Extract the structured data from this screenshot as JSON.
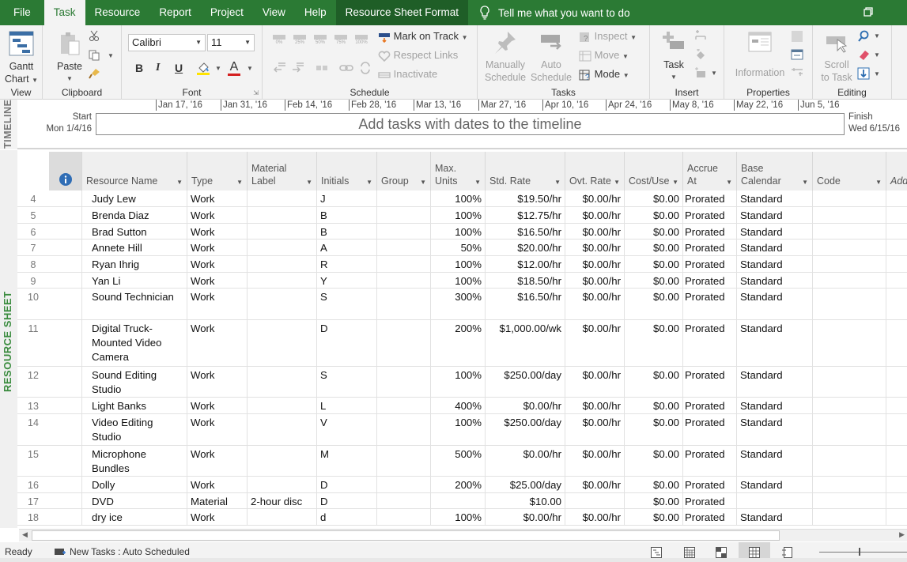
{
  "tabs": {
    "file": "File",
    "task": "Task",
    "resource": "Resource",
    "report": "Report",
    "project": "Project",
    "view": "View",
    "help": "Help",
    "context": "Resource Sheet Format",
    "tell_me": "Tell me what you want to do"
  },
  "ribbon": {
    "view_group": {
      "label": "View",
      "gantt": "Gantt",
      "chart": "Chart"
    },
    "clipboard_group": {
      "label": "Clipboard",
      "paste": "Paste"
    },
    "font_group": {
      "label": "Font",
      "font_name": "Calibri",
      "font_size": "11",
      "bold": "B",
      "italic": "I",
      "underline": "U",
      "font_color_letter": "A"
    },
    "schedule_group": {
      "label": "Schedule",
      "pct": [
        "0%",
        "25%",
        "50%",
        "75%",
        "100%"
      ],
      "mark_on_track": "Mark on Track",
      "respect_links": "Respect Links",
      "inactivate": "Inactivate"
    },
    "tasks_group": {
      "label": "Tasks",
      "manually": "Manually",
      "manually2": "Schedule",
      "auto": "Auto",
      "auto2": "Schedule",
      "inspect": "Inspect",
      "move": "Move",
      "mode": "Mode"
    },
    "insert_group": {
      "label": "Insert",
      "task": "Task"
    },
    "properties_group": {
      "label": "Properties",
      "information": "Information"
    },
    "editing_group": {
      "label": "Editing",
      "scroll": "Scroll",
      "to_task": "to Task"
    }
  },
  "timeline": {
    "side_label": "TIMELINE",
    "start_label": "Start",
    "start_date": "Mon 1/4/16",
    "finish_label": "Finish",
    "finish_date": "Wed 6/15/16",
    "placeholder": "Add tasks with dates to the timeline",
    "ticks": [
      "Jan 17, '16",
      "Jan 31, '16",
      "Feb 14, '16",
      "Feb 28, '16",
      "Mar 13, '16",
      "Mar 27, '16",
      "Apr 10, '16",
      "Apr 24, '16",
      "May 8, '16",
      "May 22, '16",
      "Jun 5, '16"
    ]
  },
  "sheet": {
    "side_label": "RESOURCE SHEET",
    "columns": [
      {
        "l1": "",
        "l2": "Resource Name"
      },
      {
        "l1": "",
        "l2": "Type"
      },
      {
        "l1": "Material",
        "l2": "Label"
      },
      {
        "l1": "",
        "l2": "Initials"
      },
      {
        "l1": "",
        "l2": "Group"
      },
      {
        "l1": "Max.",
        "l2": "Units"
      },
      {
        "l1": "",
        "l2": "Std. Rate"
      },
      {
        "l1": "",
        "l2": "Ovt. Rate"
      },
      {
        "l1": "",
        "l2": "Cost/Use"
      },
      {
        "l1": "Accrue",
        "l2": "At"
      },
      {
        "l1": "Base",
        "l2": "Calendar"
      },
      {
        "l1": "",
        "l2": "Code"
      },
      {
        "l1": "",
        "l2": "Add New Column"
      }
    ],
    "rows": [
      {
        "id": "4",
        "name": "Judy Lew",
        "type": "Work",
        "material": "",
        "initials": "J",
        "group": "",
        "max": "100%",
        "std": "$19.50/hr",
        "ovt": "$0.00/hr",
        "cost": "$0.00",
        "accrue": "Prorated",
        "cal": "Standard",
        "code": ""
      },
      {
        "id": "5",
        "name": "Brenda Diaz",
        "type": "Work",
        "material": "",
        "initials": "B",
        "group": "",
        "max": "100%",
        "std": "$12.75/hr",
        "ovt": "$0.00/hr",
        "cost": "$0.00",
        "accrue": "Prorated",
        "cal": "Standard",
        "code": ""
      },
      {
        "id": "6",
        "name": "Brad Sutton",
        "type": "Work",
        "material": "",
        "initials": "B",
        "group": "",
        "max": "100%",
        "std": "$16.50/hr",
        "ovt": "$0.00/hr",
        "cost": "$0.00",
        "accrue": "Prorated",
        "cal": "Standard",
        "code": ""
      },
      {
        "id": "7",
        "name": "Annete Hill",
        "type": "Work",
        "material": "",
        "initials": "A",
        "group": "",
        "max": "50%",
        "std": "$20.00/hr",
        "ovt": "$0.00/hr",
        "cost": "$0.00",
        "accrue": "Prorated",
        "cal": "Standard",
        "code": ""
      },
      {
        "id": "8",
        "name": "Ryan Ihrig",
        "type": "Work",
        "material": "",
        "initials": "R",
        "group": "",
        "max": "100%",
        "std": "$12.00/hr",
        "ovt": "$0.00/hr",
        "cost": "$0.00",
        "accrue": "Prorated",
        "cal": "Standard",
        "code": ""
      },
      {
        "id": "9",
        "name": "Yan Li",
        "type": "Work",
        "material": "",
        "initials": "Y",
        "group": "",
        "max": "100%",
        "std": "$18.50/hr",
        "ovt": "$0.00/hr",
        "cost": "$0.00",
        "accrue": "Prorated",
        "cal": "Standard",
        "code": ""
      },
      {
        "id": "10",
        "name": "Sound Technician",
        "type": "Work",
        "material": "",
        "initials": "S",
        "group": "",
        "max": "300%",
        "std": "$16.50/hr",
        "ovt": "$0.00/hr",
        "cost": "$0.00",
        "accrue": "Prorated",
        "cal": "Standard",
        "code": ""
      },
      {
        "id": "11",
        "name": "Digital Truck-Mounted Video Camera",
        "type": "Work",
        "material": "",
        "initials": "D",
        "group": "",
        "max": "200%",
        "std": "$1,000.00/wk",
        "ovt": "$0.00/hr",
        "cost": "$0.00",
        "accrue": "Prorated",
        "cal": "Standard",
        "code": ""
      },
      {
        "id": "12",
        "name": "Sound Editing Studio",
        "type": "Work",
        "material": "",
        "initials": "S",
        "group": "",
        "max": "100%",
        "std": "$250.00/day",
        "ovt": "$0.00/hr",
        "cost": "$0.00",
        "accrue": "Prorated",
        "cal": "Standard",
        "code": ""
      },
      {
        "id": "13",
        "name": "Light Banks",
        "type": "Work",
        "material": "",
        "initials": "L",
        "group": "",
        "max": "400%",
        "std": "$0.00/hr",
        "ovt": "$0.00/hr",
        "cost": "$0.00",
        "accrue": "Prorated",
        "cal": "Standard",
        "code": ""
      },
      {
        "id": "14",
        "name": "Video Editing Studio",
        "type": "Work",
        "material": "",
        "initials": "V",
        "group": "",
        "max": "100%",
        "std": "$250.00/day",
        "ovt": "$0.00/hr",
        "cost": "$0.00",
        "accrue": "Prorated",
        "cal": "Standard",
        "code": ""
      },
      {
        "id": "15",
        "name": "Microphone Bundles",
        "type": "Work",
        "material": "",
        "initials": "M",
        "group": "",
        "max": "500%",
        "std": "$0.00/hr",
        "ovt": "$0.00/hr",
        "cost": "$0.00",
        "accrue": "Prorated",
        "cal": "Standard",
        "code": ""
      },
      {
        "id": "16",
        "name": "Dolly",
        "type": "Work",
        "material": "",
        "initials": "D",
        "group": "",
        "max": "200%",
        "std": "$25.00/day",
        "ovt": "$0.00/hr",
        "cost": "$0.00",
        "accrue": "Prorated",
        "cal": "Standard",
        "code": ""
      },
      {
        "id": "17",
        "name": "DVD",
        "type": "Material",
        "material": "2-hour disc",
        "initials": "D",
        "group": "",
        "max": "",
        "std": "$10.00",
        "ovt": "",
        "cost": "$0.00",
        "accrue": "Prorated",
        "cal": "",
        "code": ""
      },
      {
        "id": "18",
        "name": "dry ice",
        "type": "Work",
        "material": "",
        "initials": "d",
        "group": "",
        "max": "100%",
        "std": "$0.00/hr",
        "ovt": "$0.00/hr",
        "cost": "$0.00",
        "accrue": "Prorated",
        "cal": "Standard",
        "code": ""
      }
    ]
  },
  "status": {
    "ready": "Ready",
    "new_tasks": "New Tasks : Auto Scheduled"
  },
  "colors": {
    "brand_green": "#2b7a34",
    "context_tab": "#1f5e27",
    "vertical_label": "#3b8c3f"
  }
}
